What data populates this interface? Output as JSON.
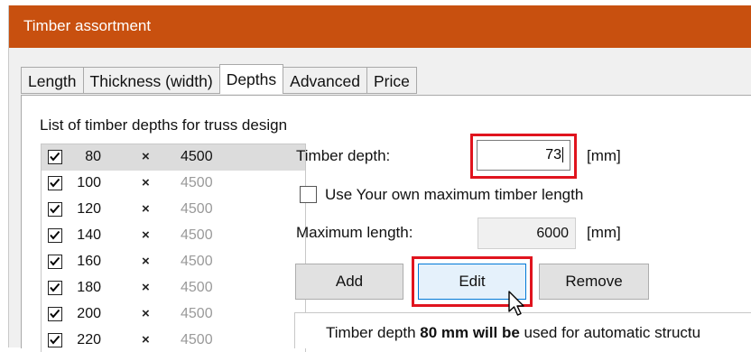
{
  "window": {
    "title": "Timber assortment",
    "accent_color": "#c8500f"
  },
  "tabs": [
    {
      "label": "Length",
      "active": false
    },
    {
      "label": "Thickness (width)",
      "active": false
    },
    {
      "label": "Depths",
      "active": true
    },
    {
      "label": "Advanced",
      "active": false
    },
    {
      "label": "Price",
      "active": false
    }
  ],
  "list": {
    "caption": "List of timber depths for truss design",
    "separator": "×",
    "rows": [
      {
        "depth": "80",
        "length": "4500",
        "checked": true,
        "selected": true
      },
      {
        "depth": "100",
        "length": "4500",
        "checked": true,
        "selected": false
      },
      {
        "depth": "120",
        "length": "4500",
        "checked": true,
        "selected": false
      },
      {
        "depth": "140",
        "length": "4500",
        "checked": true,
        "selected": false
      },
      {
        "depth": "160",
        "length": "4500",
        "checked": true,
        "selected": false
      },
      {
        "depth": "180",
        "length": "4500",
        "checked": true,
        "selected": false
      },
      {
        "depth": "200",
        "length": "4500",
        "checked": true,
        "selected": false
      },
      {
        "depth": "220",
        "length": "4500",
        "checked": true,
        "selected": false
      }
    ]
  },
  "form": {
    "depth_label": "Timber depth:",
    "depth_value": "73",
    "depth_unit": "[mm]",
    "own_length_label": "Use Your own maximum timber length",
    "own_length_checked": false,
    "max_length_label": "Maximum length:",
    "max_length_value": "6000",
    "max_length_unit": "[mm]"
  },
  "buttons": {
    "add": "Add",
    "edit": "Edit",
    "remove": "Remove"
  },
  "info": {
    "prefix": "Timber depth ",
    "bold": "80 mm will be",
    "suffix": " used for automatic structu"
  },
  "highlight_color": "#e0141e"
}
